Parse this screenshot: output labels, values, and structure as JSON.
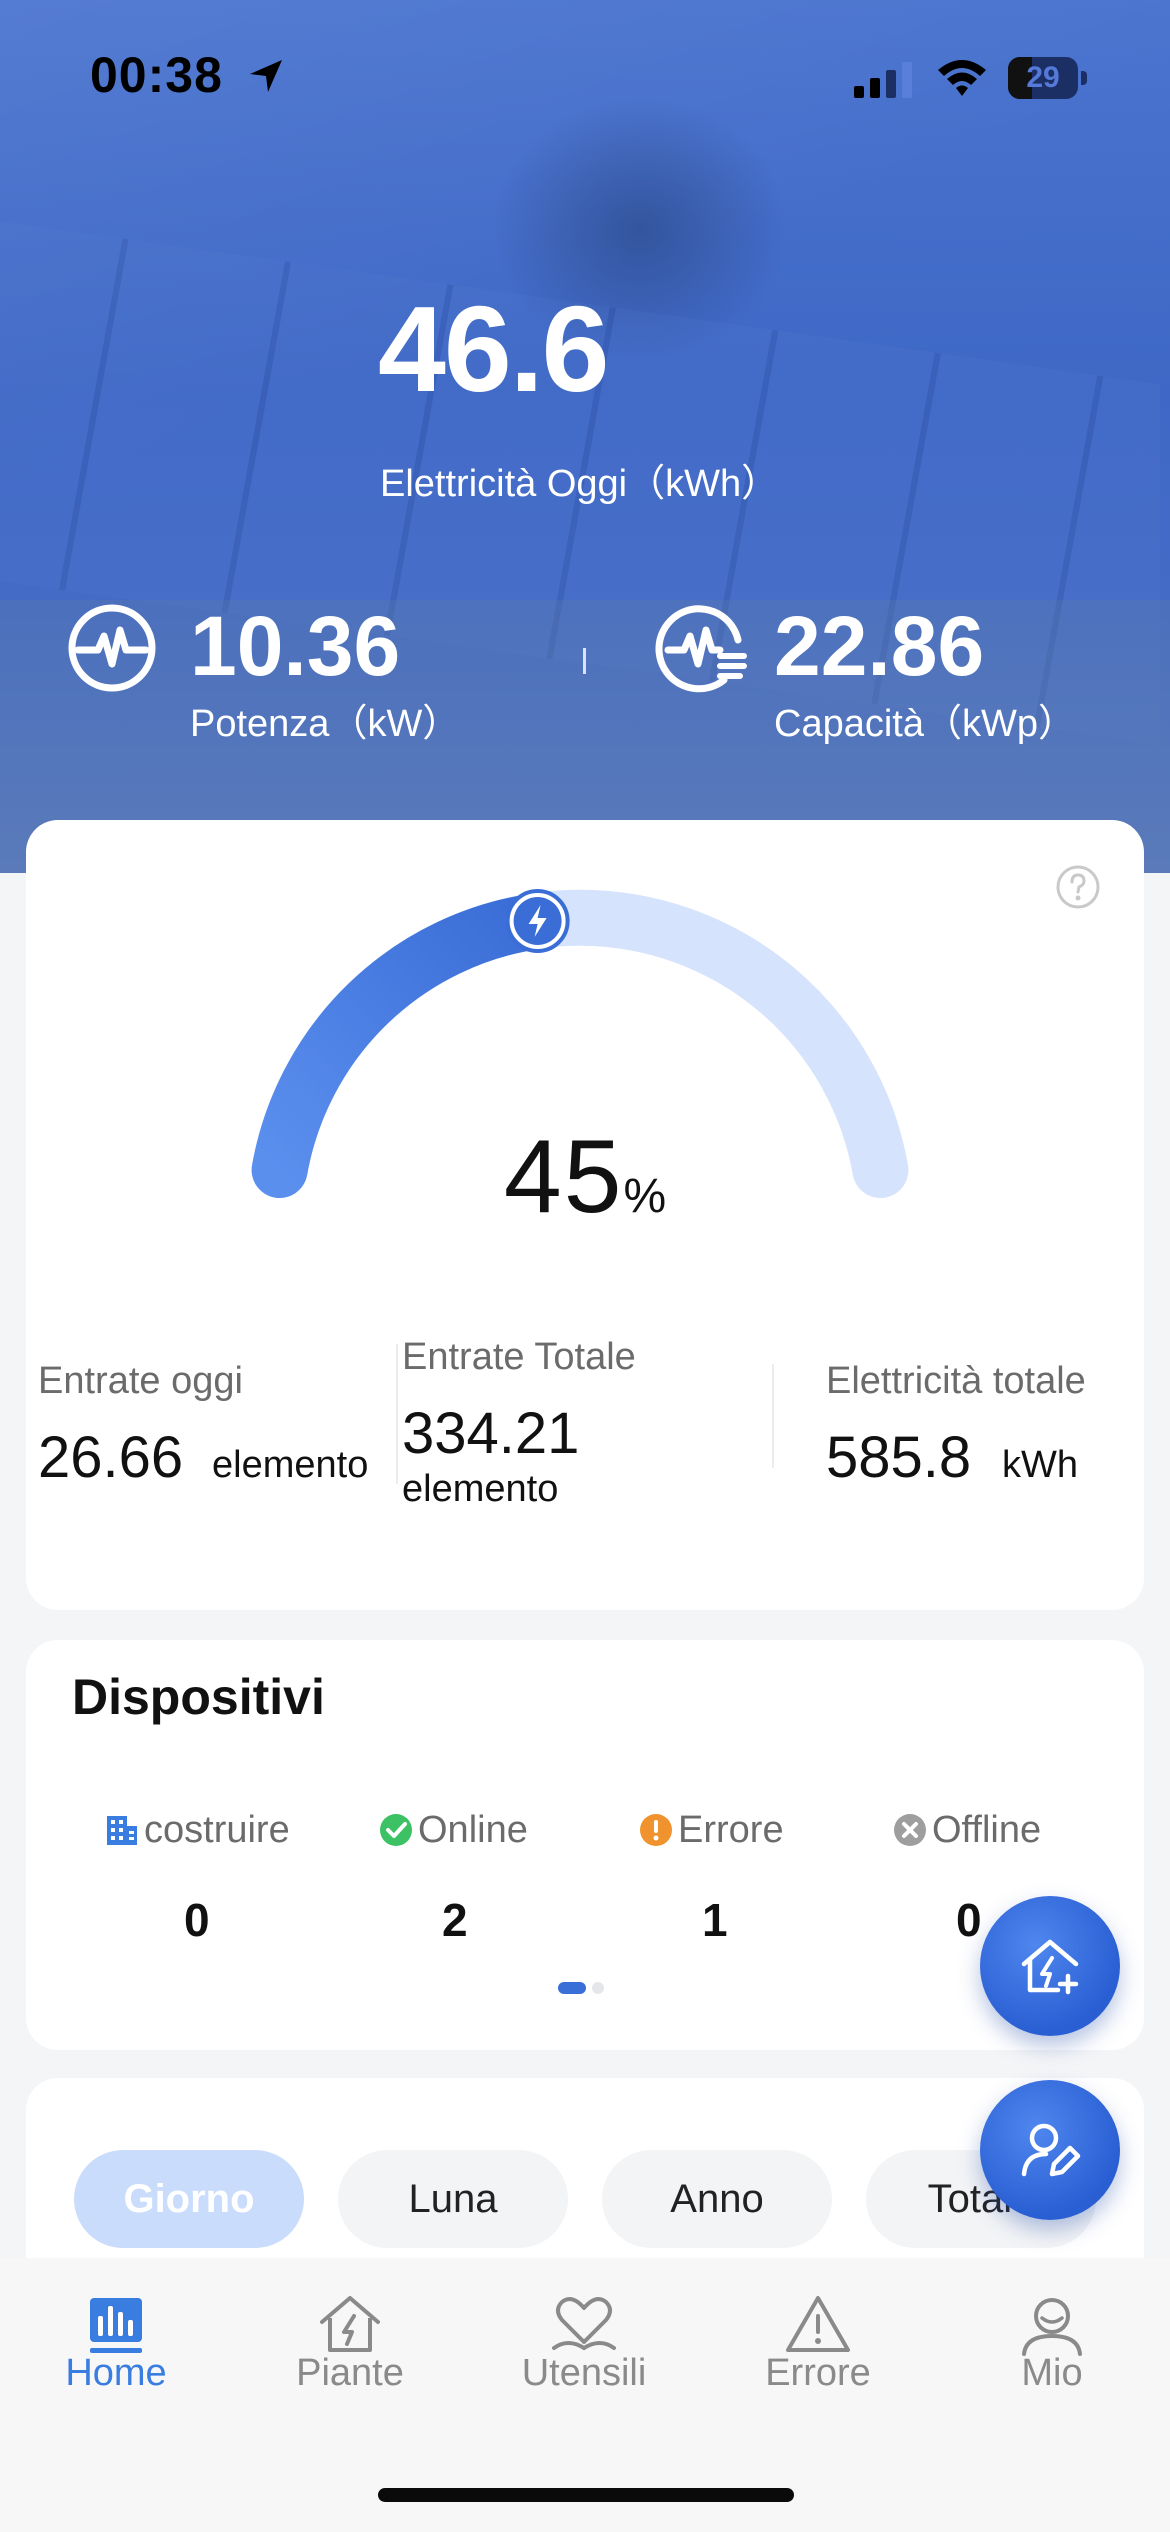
{
  "status_bar": {
    "time": "00:38",
    "battery": "29",
    "location_icon": "location-arrow-icon",
    "signal_icon": "cellular-signal-icon",
    "wifi_icon": "wifi-icon"
  },
  "hero": {
    "today_value": "46.6",
    "today_label": "Elettricità Oggi（kWh）",
    "power": {
      "value": "10.36",
      "label": "Potenza（kW）",
      "icon": "power-pulse-icon"
    },
    "capacity": {
      "value": "22.86",
      "label": "Capacità（kWp）",
      "icon": "capacity-pulse-icon"
    }
  },
  "gauge": {
    "value": "45",
    "unit": "%",
    "fraction": 0.45,
    "help_icon": "help-circle-icon",
    "marker_icon": "lightning-icon"
  },
  "stats": {
    "income_today": {
      "label": "Entrate oggi",
      "value": "26.66",
      "unit": "elemento"
    },
    "income_total": {
      "label": "Entrate Totale",
      "value": "334.21",
      "unit": "elemento"
    },
    "energy_total": {
      "label": "Elettricità totale",
      "value": "585.8",
      "unit": "kWh"
    }
  },
  "devices": {
    "title": "Dispositivi",
    "items": [
      {
        "label": "costruire",
        "count": "0",
        "icon": "building-icon"
      },
      {
        "label": "Online",
        "count": "2",
        "icon": "check-circle-icon"
      },
      {
        "label": "Errore",
        "count": "1",
        "icon": "alert-circle-icon"
      },
      {
        "label": "Offline",
        "count": "0",
        "icon": "x-circle-icon"
      }
    ]
  },
  "periods": [
    "Giorno",
    "Luna",
    "Anno",
    "Totale"
  ],
  "fabs": [
    {
      "icon": "home-add-icon"
    },
    {
      "icon": "user-edit-icon"
    }
  ],
  "tabs": [
    {
      "label": "Home",
      "icon": "bar-chart-icon",
      "active": true
    },
    {
      "label": "Piante",
      "icon": "house-lightning-icon"
    },
    {
      "label": "Utensili",
      "icon": "heart-hand-icon"
    },
    {
      "label": "Errore",
      "icon": "warning-triangle-icon"
    },
    {
      "label": "Mio",
      "icon": "user-icon"
    }
  ],
  "colors": {
    "accent": "#3a7de0",
    "hero_blue": "#4a74cf",
    "online": "#3cc264",
    "error": "#f0922e",
    "offline": "#9e9e9e"
  }
}
